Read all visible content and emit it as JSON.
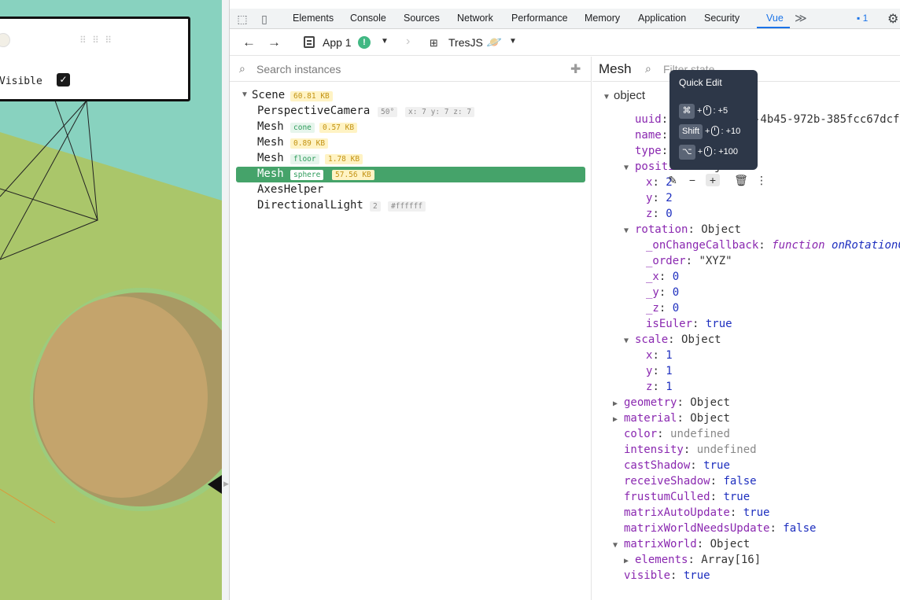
{
  "viewport": {
    "panel": {
      "visible_label": "Visible"
    }
  },
  "devtools": {
    "tabs": [
      "Elements",
      "Console",
      "Sources",
      "Network",
      "Performance",
      "Memory",
      "Application",
      "Security",
      "Vue"
    ],
    "active_tab": "Vue",
    "issues_count": "1",
    "navbar": {
      "app_label": "App 1",
      "app_badge": "!",
      "breadcrumb": "TresJS",
      "planet_icon": "🪐"
    },
    "tree": {
      "search_placeholder": "Search instances",
      "rows": [
        {
          "name": "Scene",
          "size": "60.81 KB"
        },
        {
          "name": "PerspectiveCamera",
          "fov": "50°",
          "pos": "x: 7 y: 7 z: 7"
        },
        {
          "name": "Mesh",
          "tag": "cone",
          "size": "0.57 KB"
        },
        {
          "name": "Mesh",
          "size": "0.89 KB"
        },
        {
          "name": "Mesh",
          "tag": "floor",
          "size": "1.78 KB"
        },
        {
          "name": "Mesh",
          "tag": "sphere",
          "size": "57.56 KB"
        },
        {
          "name": "AxesHelper"
        },
        {
          "name": "DirectionalLight",
          "count": "2",
          "color": "#ffffff"
        }
      ]
    },
    "state": {
      "title": "Mesh",
      "filter_placeholder": "Filter state",
      "section": "object",
      "uuid_key": "uuid",
      "uuid_value_start": "\"",
      "uuid_value_end": "-4b45-972b-385fcc67dcf",
      "name_key": "name",
      "name_value": "\"",
      "type_key": "type",
      "type_value": "\"",
      "position_key": "position",
      "position_value": "Object",
      "position": {
        "x": "2",
        "y": "2",
        "z": "0"
      },
      "rotation_key": "rotation",
      "rotation_value": "Object",
      "rotation": {
        "onchange_key": "_onChangeCallback",
        "onchange_fn": "function",
        "onchange_name": "onRotationCha",
        "order_key": "_order",
        "order_value": "\"XYZ\"",
        "x": "0",
        "y": "0",
        "z": "0",
        "iseuler_key": "isEuler",
        "iseuler_value": "true"
      },
      "scale_key": "scale",
      "scale_value": "Object",
      "scale": {
        "x": "1",
        "y": "1",
        "z": "1"
      },
      "geometry_key": "geometry",
      "geometry_value": "Object",
      "material_key": "material",
      "material_value": "Object",
      "color_key": "color",
      "color_value": "undefined",
      "intensity_key": "intensity",
      "intensity_value": "undefined",
      "castshadow_key": "castShadow",
      "castshadow_value": "true",
      "receiveshadow_key": "receiveShadow",
      "receiveshadow_value": "false",
      "frustum_key": "frustumCulled",
      "frustum_value": "true",
      "mau_key": "matrixAutoUpdate",
      "mau_value": "true",
      "mwnu_key": "matrixWorldNeedsUpdate",
      "mwnu_value": "false",
      "mw_key": "matrixWorld",
      "mw_value": "Object",
      "elements_key": "elements",
      "elements_value": "Array[16]",
      "visible_key": "visible",
      "visible_value": "true"
    },
    "tooltip": {
      "title": "Quick Edit",
      "rows": [
        {
          "key": "⌘",
          "amount": ": +5"
        },
        {
          "key": "Shift",
          "amount": ": +10"
        },
        {
          "key": "⌥",
          "amount": ": +100"
        }
      ]
    }
  },
  "colors": {
    "accent_vue": "#45a36a",
    "devtools_blue": "#1a73e8",
    "sky": "#8fd3c2",
    "ground": "#aac66a",
    "sphere": "#c4a46c"
  }
}
